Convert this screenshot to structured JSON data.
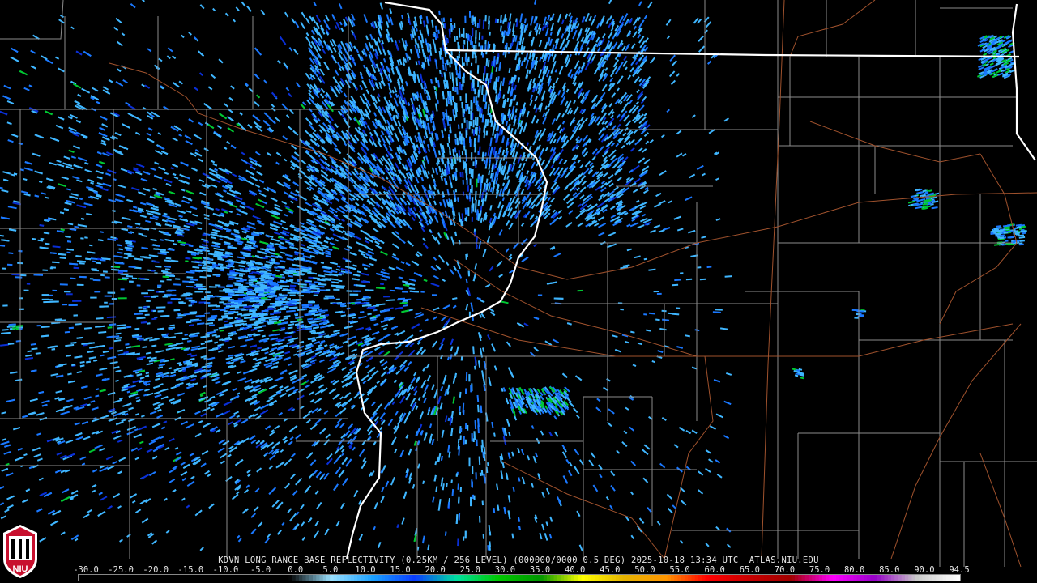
{
  "map": {
    "product_caption": "KDVN LONG RANGE BASE REFLECTIVITY (0.25KM / 256 LEVEL) (000000/0000 0.5 DEG) 2025-10-18 13:34 UTC  ATLAS.NIU.EDU",
    "scale_values": [
      "-30.0",
      "-25.0",
      "-20.0",
      "-15.0",
      "-10.0",
      "-5.0",
      "0.0",
      "5.0",
      "10.0",
      "15.0",
      "20.0",
      "25.0",
      "30.0",
      "35.0",
      "40.0",
      "45.0",
      "50.0",
      "55.0",
      "60.0",
      "65.0",
      "70.0",
      "75.0",
      "80.0",
      "85.0",
      "90.0",
      "94.5"
    ],
    "colorbar_colors": [
      "#000000",
      "#000000",
      "#000000",
      "#000000",
      "#000000",
      "#000000",
      "#9be1ff",
      "#1aa0ff",
      "#0a3cff",
      "#00e0a0",
      "#00c800",
      "#009600",
      "#ffff00",
      "#e6b400",
      "#ff9600",
      "#ff0000",
      "#c80000",
      "#a00000",
      "#ff00ff",
      "#9600c8",
      "#c8c8c8",
      "#ffffff"
    ],
    "logo_text": "NIU",
    "colors": {
      "state_border": "#ffffff",
      "county_border": "#8c8c8c",
      "roads": "#a0522d",
      "echo_light": "#3fb6ff",
      "echo_mid": "#1a78ff",
      "echo_dark": "#0a2fd6",
      "echo_green": "#00c832"
    }
  }
}
